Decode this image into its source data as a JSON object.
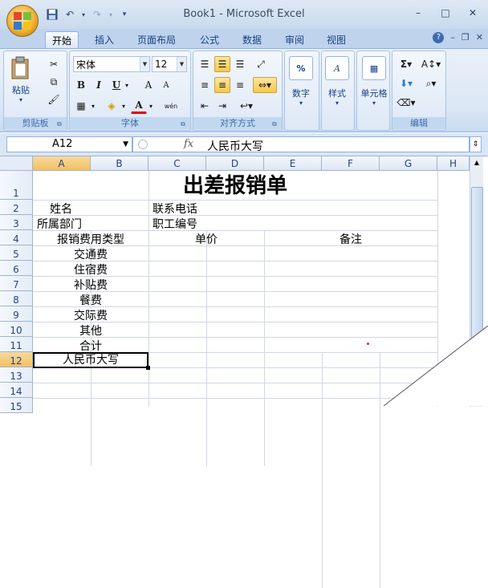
{
  "window": {
    "title": "Book1 - Microsoft Excel",
    "minimize": "–",
    "maximize": "□",
    "close": "✕"
  },
  "qat": {
    "save": "💾",
    "undo": "↶",
    "redo": "↷",
    "customize": "▾"
  },
  "tabs": [
    {
      "label": "开始",
      "active": true
    },
    {
      "label": "插入"
    },
    {
      "label": "页面布局"
    },
    {
      "label": "公式"
    },
    {
      "label": "数据"
    },
    {
      "label": "审阅"
    },
    {
      "label": "视图"
    }
  ],
  "ribbon": {
    "clipboard": {
      "label": "剪贴板",
      "paste": "粘贴"
    },
    "font": {
      "label": "字体",
      "name": "宋体",
      "size": "12",
      "bold": "B",
      "italic": "I",
      "underline": "U",
      "grow": "A",
      "shrink": "A",
      "font_color": "A",
      "wen": "wén"
    },
    "alignment": {
      "label": "对齐方式"
    },
    "number": {
      "label": "数字",
      "symbol": "%"
    },
    "styles": {
      "label": "样式"
    },
    "cells": {
      "label": "单元格"
    },
    "editing": {
      "label": "编辑",
      "sum": "Σ"
    }
  },
  "formula_bar": {
    "cell_ref": "A12",
    "fx": "fx",
    "content": "人民币大写"
  },
  "columns": [
    "A",
    "B",
    "C",
    "D",
    "E",
    "F",
    "G",
    "H"
  ],
  "rows": [
    "1",
    "2",
    "3",
    "4",
    "5",
    "6",
    "7",
    "8",
    "9",
    "10",
    "11",
    "12",
    "13",
    "14",
    "15"
  ],
  "cells": {
    "title": "出差报销单",
    "name": "姓名",
    "phone": "联系电话",
    "dept": "所属部门",
    "staff_no": "职工编号",
    "expense_type": "报销费用类型",
    "unit_price": "单价",
    "remark": "备注",
    "transport": "交通费",
    "lodging": "住宿费",
    "subsidy": "补贴费",
    "meal": "餐费",
    "social": "交际费",
    "other": "其他",
    "total": "合计",
    "rmb_upper": "人民币大写"
  },
  "selected_cell": "A12"
}
